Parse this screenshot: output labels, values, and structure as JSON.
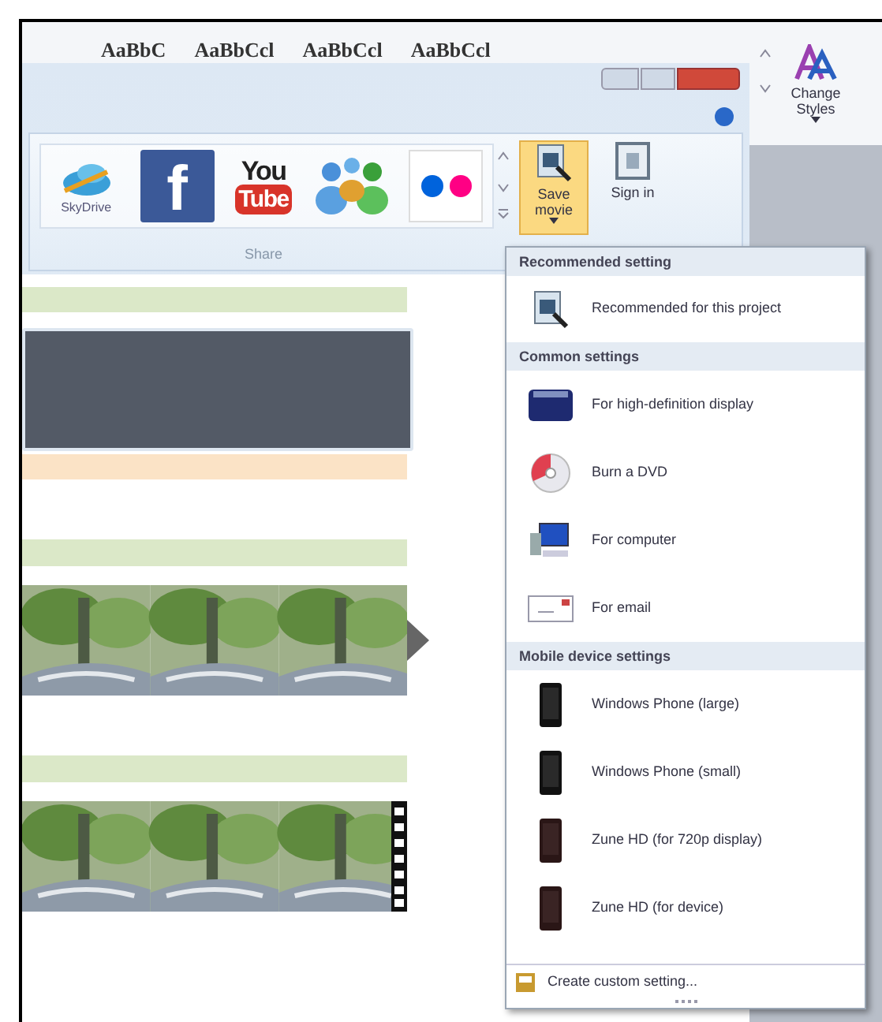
{
  "word_ribbon": {
    "style_gallery": [
      "AaBbC",
      "AaBbCcl",
      "AaBbCcl",
      "AaBbCcl"
    ],
    "change_styles": {
      "label": "Change Styles"
    }
  },
  "movie_maker": {
    "share_group": {
      "label": "Share",
      "services": [
        {
          "kind": "skydrive",
          "label": "SkyDrive"
        },
        {
          "kind": "facebook",
          "logo_text": "f"
        },
        {
          "kind": "youtube",
          "logo_text": [
            "You",
            "Tube"
          ]
        },
        {
          "kind": "people"
        },
        {
          "kind": "flickr"
        }
      ]
    },
    "save_movie": {
      "label": "Save movie",
      "expanded": true
    },
    "sign_in": {
      "label": "Sign in"
    }
  },
  "storyboard": {
    "clips": [
      {
        "kind": "title"
      },
      {
        "kind": "video",
        "marker": {
          "kind": "arrow"
        }
      },
      {
        "kind": "video",
        "marker": {
          "kind": "film"
        }
      }
    ]
  },
  "save_menu": {
    "sections": [
      {
        "title": "Recommended setting",
        "items": [
          {
            "kind": "project",
            "label": "Recommended for this project"
          }
        ]
      },
      {
        "title": "Common settings",
        "items": [
          {
            "kind": "hd",
            "label": "For high-definition display"
          },
          {
            "kind": "dvd",
            "label": "Burn a DVD"
          },
          {
            "kind": "computer",
            "label": "For computer"
          },
          {
            "kind": "email",
            "label": "For email"
          }
        ]
      },
      {
        "title": "Mobile device settings",
        "items": [
          {
            "kind": "phone",
            "label": "Windows Phone (large)"
          },
          {
            "kind": "phone",
            "label": "Windows Phone (small)"
          },
          {
            "kind": "zune",
            "label": "Zune HD (for 720p display)"
          },
          {
            "kind": "zune",
            "label": "Zune HD (for device)"
          }
        ]
      }
    ],
    "footer": "Create custom setting..."
  }
}
